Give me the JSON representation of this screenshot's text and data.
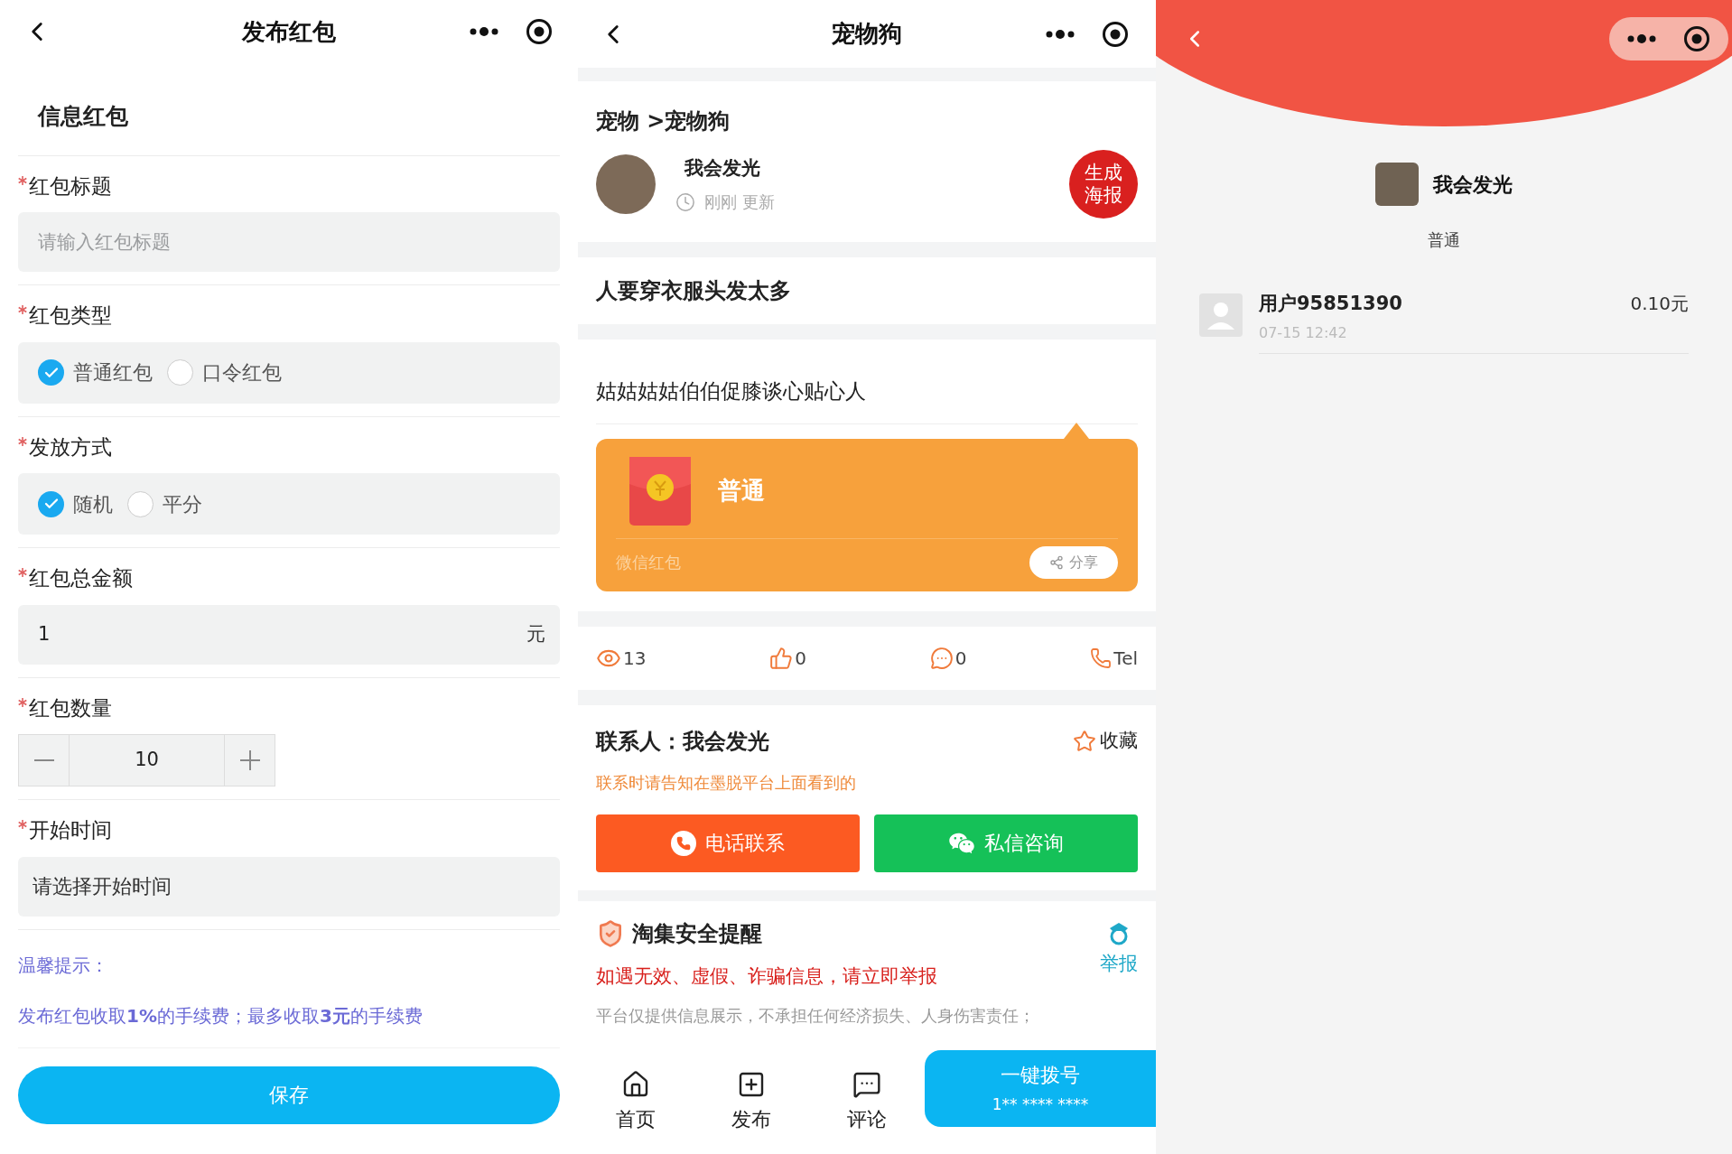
{
  "publish": {
    "title": "发布红包",
    "section_title": "信息红包",
    "fields": [
      {
        "kind": "text",
        "label": "红包标题",
        "required": true,
        "placeholder": "请输入红包标题"
      },
      {
        "kind": "radio",
        "label": "红包类型",
        "required": true,
        "options": [
          {
            "label": "普通红包",
            "selected": true
          },
          {
            "label": "口令红包",
            "selected": false
          }
        ]
      },
      {
        "kind": "radio",
        "label": "发放方式",
        "required": true,
        "options": [
          {
            "label": "随机",
            "selected": true
          },
          {
            "label": "平分",
            "selected": false
          }
        ]
      },
      {
        "kind": "amount",
        "label": "红包总金额",
        "required": true,
        "value": "1",
        "unit": "元"
      },
      {
        "kind": "stepper",
        "label": "红包数量",
        "required": true,
        "value": "10"
      },
      {
        "kind": "picker",
        "label": "开始时间",
        "required": true,
        "value": "请选择开始时间"
      }
    ],
    "tip_title": "温馨提示：",
    "tip": "发布红包收取**1%**的手续费；最多收取**3元**的手续费",
    "save_button": "保存"
  },
  "post": {
    "title": "宠物狗",
    "breadcrumb": "宠物 >宠物狗",
    "author": "我会发光",
    "updated": "刚刚 更新",
    "poster_button": "生成海报",
    "headline": "人要穿衣服头发太多",
    "body": "姑姑姑姑伯伯促膝谈心贴心人",
    "red_packet": {
      "name": "普通",
      "source": "微信红包",
      "share": "分享"
    },
    "stats": [
      {
        "kind": "views",
        "value": "13"
      },
      {
        "kind": "likes",
        "value": "0"
      },
      {
        "kind": "comments",
        "value": "0"
      },
      {
        "kind": "phone",
        "value": "Tel"
      }
    ],
    "contact": {
      "heading": "联系人：我会发光",
      "favorite": "收藏",
      "note": "联系时请告知在墨脱平台上面看到的",
      "buttons": [
        {
          "kind": "call",
          "label": "电话联系"
        },
        {
          "kind": "message",
          "label": "私信咨询"
        }
      ]
    },
    "safety": {
      "title": "淘集安全提醒",
      "report": "举报",
      "warning": "如遇无效、虚假、诈骗信息，请立即举报",
      "disclaimer": "平台仅提供信息展示，不承担任何经济损失、人身伤害责任；"
    },
    "nav": [
      {
        "kind": "home",
        "label": "首页"
      },
      {
        "kind": "publish",
        "label": "发布"
      },
      {
        "kind": "comment",
        "label": "评论"
      }
    ],
    "dial": {
      "label": "一键拨号",
      "number": "1** **** ****"
    }
  },
  "redpacket_detail": {
    "sender": "我会发光",
    "type": "普通",
    "records": [
      {
        "user": "用户95851390",
        "time": "07-15 12:42",
        "amount": "0.10元"
      }
    ]
  }
}
